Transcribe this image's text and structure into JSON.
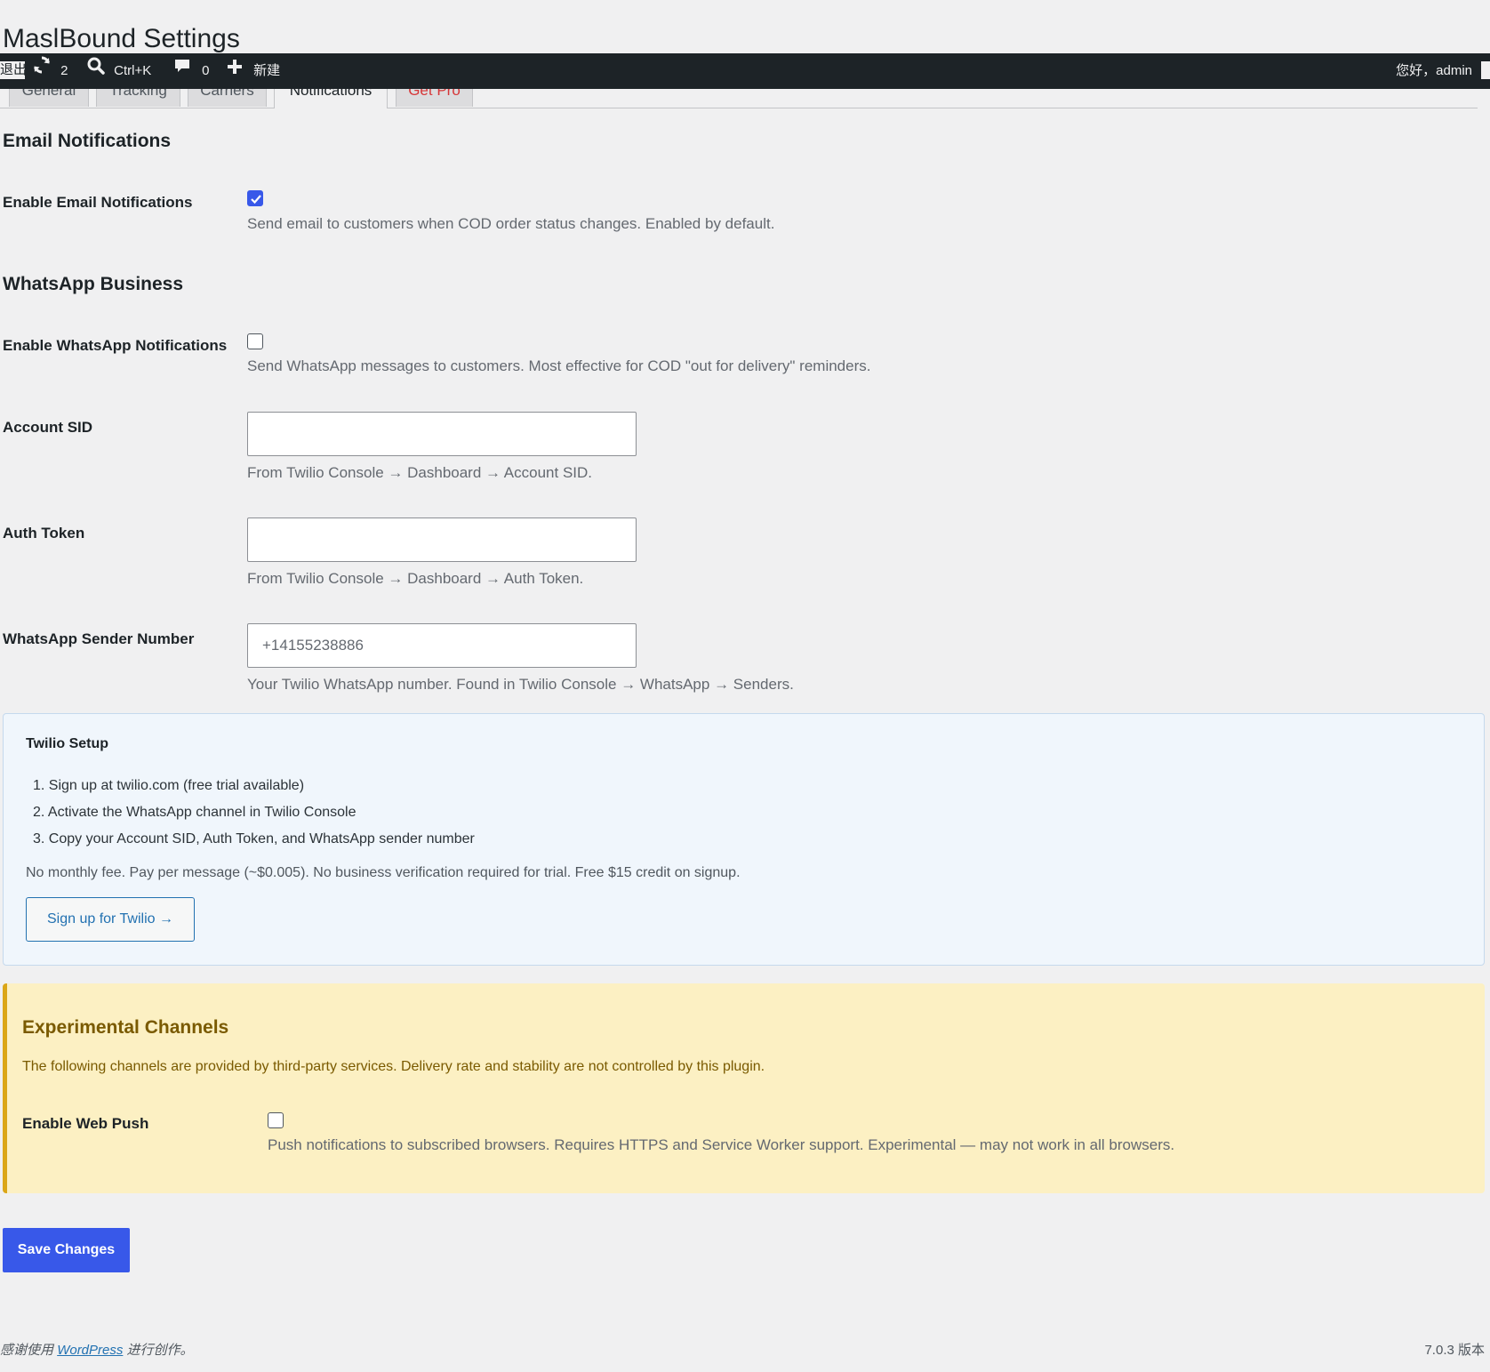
{
  "page": {
    "title": "MaslBound Settings"
  },
  "adminbar": {
    "exit_label": "退出",
    "updates_count": "2",
    "search_shortcut": "Ctrl+K",
    "comments_count": "0",
    "new_label": "新建",
    "greeting": "您好，admin"
  },
  "tabs": [
    {
      "label": "General"
    },
    {
      "label": "Tracking"
    },
    {
      "label": "Carriers"
    },
    {
      "label": "Notifications"
    },
    {
      "label": "Get Pro"
    }
  ],
  "email_section": {
    "heading": "Email Notifications",
    "enable_label": "Enable Email Notifications",
    "enabled": true,
    "description": "Send email to customers when COD order status changes. Enabled by default."
  },
  "whatsapp_section": {
    "heading": "WhatsApp Business",
    "enable_label": "Enable WhatsApp Notifications",
    "enabled": false,
    "enable_description": "Send WhatsApp messages to customers. Most effective for COD \"out for delivery\" reminders.",
    "account_sid": {
      "label": "Account SID",
      "value": "",
      "description": "From Twilio Console → Dashboard → Account SID."
    },
    "auth_token": {
      "label": "Auth Token",
      "value": "",
      "description": "From Twilio Console → Dashboard → Auth Token."
    },
    "sender_number": {
      "label": "WhatsApp Sender Number",
      "placeholder": "+14155238886",
      "description": "Your Twilio WhatsApp number. Found in Twilio Console → WhatsApp → Senders."
    }
  },
  "twilio_setup": {
    "title": "Twilio Setup",
    "steps": [
      "1. Sign up at twilio.com (free trial available)",
      "2. Activate the WhatsApp channel in Twilio Console",
      "3. Copy your Account SID, Auth Token, and WhatsApp sender number"
    ],
    "note": "No monthly fee. Pay per message (~$0.005). No business verification required for trial. Free $15 credit on signup.",
    "button_label": "Sign up for Twilio →"
  },
  "experimental": {
    "title": "Experimental Channels",
    "description": "The following channels are provided by third-party services. Delivery rate and stability are not controlled by this plugin.",
    "web_push_label": "Enable Web Push",
    "web_push_enabled": false,
    "web_push_description": "Push notifications to subscribed browsers. Requires HTTPS and Service Worker support. Experimental — may not work in all browsers."
  },
  "save_button": "Save Changes",
  "footer": {
    "thanks_prefix": "感谢使用",
    "wordpress_link": "WordPress",
    "thanks_suffix": "进行创作。",
    "version": "7.0.3 版本"
  },
  "colors": {
    "accent": "#3858e9",
    "link": "#2271b1",
    "adminbar": "#1d2327",
    "notice_bg": "#fcf0c3",
    "notice_border": "#dba617",
    "info_bg": "#f0f6fc"
  }
}
